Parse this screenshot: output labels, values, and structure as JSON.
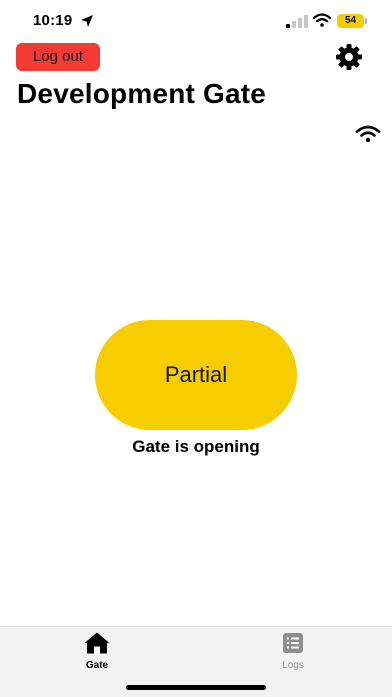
{
  "status_bar": {
    "time": "10:19",
    "battery": "54",
    "icons": [
      "location-arrow-icon",
      "cellular-signal-icon",
      "wifi-icon",
      "battery-icon"
    ],
    "battery_color": "#f5cc00"
  },
  "header": {
    "logout_label": "Log out",
    "logout_color": "#f23b35",
    "settings_icon": "gear-icon",
    "title": "Development Gate",
    "connection_icon": "wifi-icon"
  },
  "main": {
    "gate_button_label": "Partial",
    "gate_button_color": "#f8cd00",
    "status_text": "Gate is opening"
  },
  "tab_bar": {
    "tabs": [
      {
        "label": "Gate",
        "icon": "house-icon",
        "selected": true
      },
      {
        "label": "Logs",
        "icon": "list-icon",
        "selected": false
      }
    ]
  }
}
